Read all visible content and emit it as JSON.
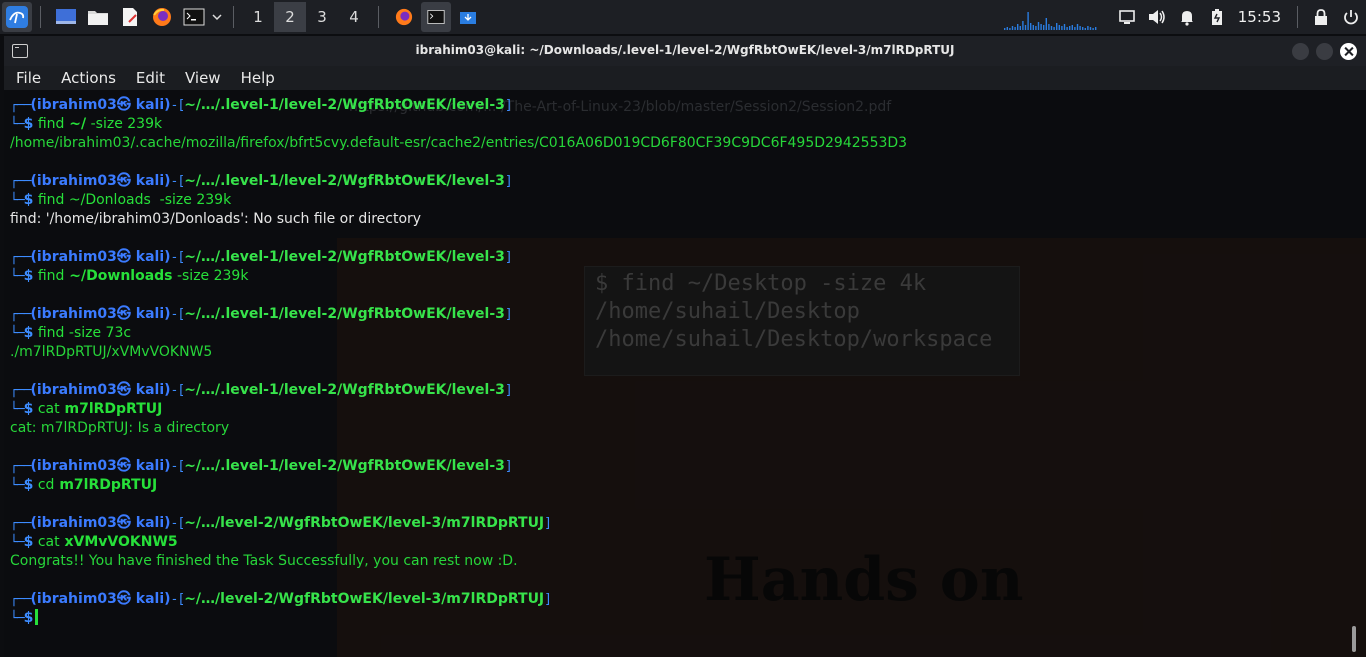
{
  "panel": {
    "workspaces": [
      "1",
      "2",
      "3",
      "4"
    ],
    "active_workspace": "2",
    "clock": "15:53"
  },
  "window": {
    "title": "ibrahim03@kali: ~/Downloads/.level-1/level-2/WgfRbtOwEK/level-3/m7lRDpRTUJ"
  },
  "menu": [
    "File",
    "Actions",
    "Edit",
    "View",
    "Help"
  ],
  "background": {
    "url": "https://github.com/... /The-Art-of-Linux-23/blob/master/Session2/Session2.pdf",
    "code_lines": [
      "$ find ~/Desktop -size 4k",
      "/home/suhail/Desktop",
      "/home/suhail/Desktop/workspace"
    ],
    "hands_on": "Hands on"
  },
  "terminal": {
    "user": "(ibrahim03㉿ kali)",
    "blocks": [
      {
        "path": "~/…/.level-1/level-2/WgfRbtOwEK/level-3",
        "cmd": "find",
        "args": [
          {
            "t": " ~/",
            "b": true
          },
          {
            "t": " -size",
            "b": false
          },
          {
            "t": " 239k",
            "b": false
          }
        ],
        "output": [
          {
            "text": "/home/ibrahim03/.cache/mozilla/firefox/bfrt5cvy.default-esr/cache2/entries/C016A06D019CD6F80CF39C9DC6F495D2942553D3",
            "color": "green"
          }
        ]
      },
      {
        "path": "~/…/.level-1/level-2/WgfRbtOwEK/level-3",
        "cmd": "find",
        "args": [
          {
            "t": " ~/Donloads",
            "b": false
          },
          {
            "t": "  -size",
            "b": false
          },
          {
            "t": " 239k",
            "b": false
          }
        ],
        "output": [
          {
            "text": "find: '/home/ibrahim03/Donloads': No such file or directory",
            "color": "white"
          }
        ]
      },
      {
        "path": "~/…/.level-1/level-2/WgfRbtOwEK/level-3",
        "cmd": "find",
        "args": [
          {
            "t": " ~/Downloads",
            "b": true
          },
          {
            "t": " -size",
            "b": false
          },
          {
            "t": " 239k",
            "b": false
          }
        ],
        "output": []
      },
      {
        "path": "~/…/.level-1/level-2/WgfRbtOwEK/level-3",
        "cmd": "find",
        "args": [
          {
            "t": " -size",
            "b": false
          },
          {
            "t": " 73c",
            "b": false
          }
        ],
        "output": [
          {
            "text": "./m7lRDpRTUJ/xVMvVOKNW5",
            "color": "green"
          }
        ]
      },
      {
        "path": "~/…/.level-1/level-2/WgfRbtOwEK/level-3",
        "cmd": "cat",
        "args": [
          {
            "t": " m7lRDpRTUJ",
            "b": true
          }
        ],
        "output": [
          {
            "text": "cat: m7lRDpRTUJ: Is a directory",
            "color": "green"
          }
        ]
      },
      {
        "path": "~/…/.level-1/level-2/WgfRbtOwEK/level-3",
        "cmd": "cd",
        "args": [
          {
            "t": " m7lRDpRTUJ",
            "b": true
          }
        ],
        "output": []
      },
      {
        "path": "~/…/level-2/WgfRbtOwEK/level-3/m7lRDpRTUJ",
        "cmd": "cat",
        "args": [
          {
            "t": " xVMvVOKNW5",
            "b": true
          }
        ],
        "output": [
          {
            "text": "Congrats!! You have finished the Task Successfully, you can rest now :D.",
            "color": "green"
          }
        ]
      },
      {
        "path": "~/…/level-2/WgfRbtOwEK/level-3/m7lRDpRTUJ",
        "cmd": "",
        "args": [],
        "output": [],
        "cursor": true
      }
    ]
  }
}
